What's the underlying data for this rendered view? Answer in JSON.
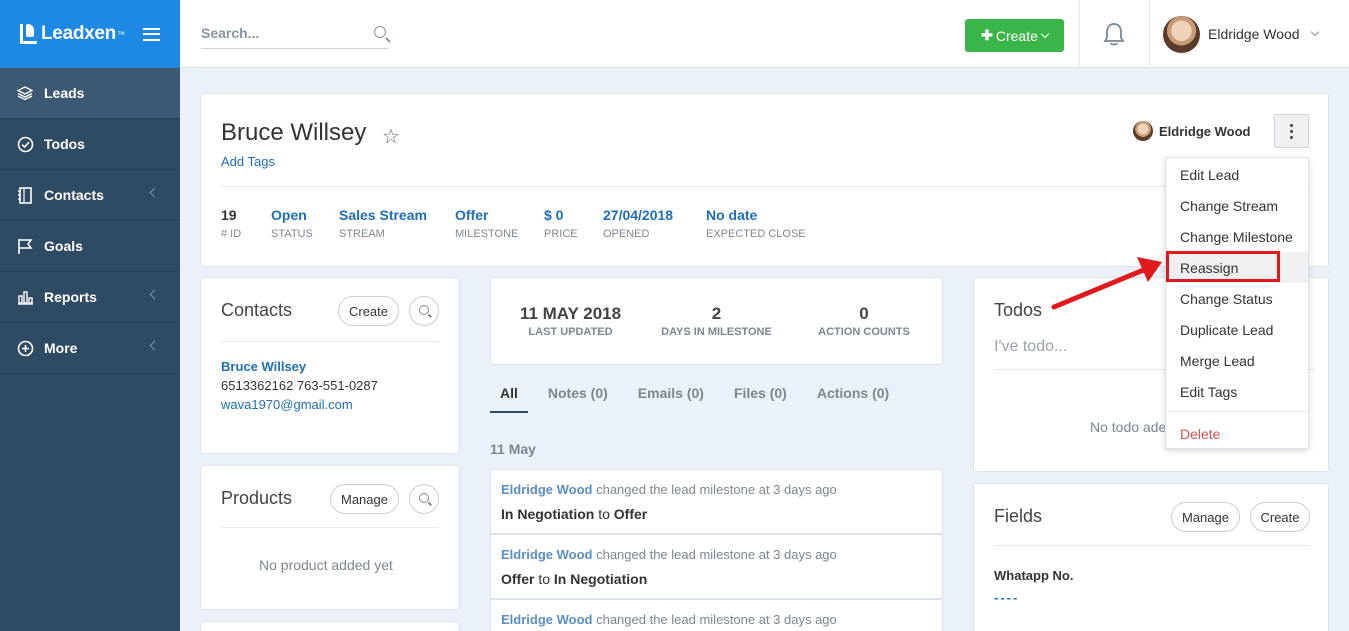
{
  "brand": {
    "name": "Leadxen",
    "tm": "™"
  },
  "sidebar": {
    "items": [
      {
        "label": "Leads",
        "icon": "layers-icon"
      },
      {
        "label": "Todos",
        "icon": "check-circle-icon"
      },
      {
        "label": "Contacts",
        "icon": "address-book-icon"
      },
      {
        "label": "Goals",
        "icon": "flag-icon"
      },
      {
        "label": "Reports",
        "icon": "bar-chart-icon"
      },
      {
        "label": "More",
        "icon": "plus-circle-icon"
      }
    ]
  },
  "topbar": {
    "search_placeholder": "Search...",
    "create_label": "Create",
    "user_name": "Eldridge Wood"
  },
  "lead": {
    "name": "Bruce Willsey",
    "add_tags": "Add Tags",
    "owner": "Eldridge Wood",
    "stats": [
      {
        "value": "19",
        "label": "# ID"
      },
      {
        "value": "Open",
        "label": "STATUS"
      },
      {
        "value": "Sales Stream",
        "label": "STREAM"
      },
      {
        "value": "Offer",
        "label": "MILESTONE"
      },
      {
        "value": "$ 0",
        "label": "PRICE"
      },
      {
        "value": "27/04/2018",
        "label": "OPENED"
      },
      {
        "value": "No date",
        "label": "EXPECTED CLOSE"
      }
    ]
  },
  "contacts": {
    "title": "Contacts",
    "create_label": "Create",
    "name": "Bruce Willsey",
    "phones": "6513362162 763-551-0287",
    "email": "wava1970@gmail.com"
  },
  "products": {
    "title": "Products",
    "manage_label": "Manage",
    "empty": "No product added yet"
  },
  "summary": [
    {
      "value": "11 MAY 2018",
      "label": "LAST UPDATED"
    },
    {
      "value": "2",
      "label": "DAYS IN MILESTONE"
    },
    {
      "value": "0",
      "label": "ACTION COUNTS"
    }
  ],
  "tabs": [
    "All",
    "Notes (0)",
    "Emails (0)",
    "Files (0)",
    "Actions (0)"
  ],
  "activity_date": "11 May",
  "activities": [
    {
      "who": "Eldridge Wood",
      "text": " changed the lead milestone at 3 days ago",
      "from": "In Negotiation",
      "to_word": " to ",
      "to": "Offer"
    },
    {
      "who": "Eldridge Wood",
      "text": " changed the lead milestone at 3 days ago",
      "from": "Offer",
      "to_word": " to ",
      "to": "In Negotiation"
    },
    {
      "who": "Eldridge Wood",
      "text": " changed the lead milestone at 3 days ago",
      "from": "",
      "to_word": "",
      "to": ""
    }
  ],
  "todos": {
    "title": "Todos",
    "placeholder": "I've todo...",
    "empty": "No todo ade"
  },
  "fields": {
    "title": "Fields",
    "manage_label": "Manage",
    "create_label": "Create",
    "field_label": "Whatapp No.",
    "field_value": "----"
  },
  "dropdown": {
    "items": [
      "Edit Lead",
      "Change Stream",
      "Change Milestone",
      "Reassign",
      "Change Status",
      "Duplicate Lead",
      "Merge Lead",
      "Edit Tags"
    ],
    "delete_label": "Delete"
  },
  "colors": {
    "brand": "#1e88e5",
    "sidebar": "#2f4a63",
    "create": "#3ab54a",
    "link": "#1e6fb8",
    "highlight": "#e0191d"
  }
}
